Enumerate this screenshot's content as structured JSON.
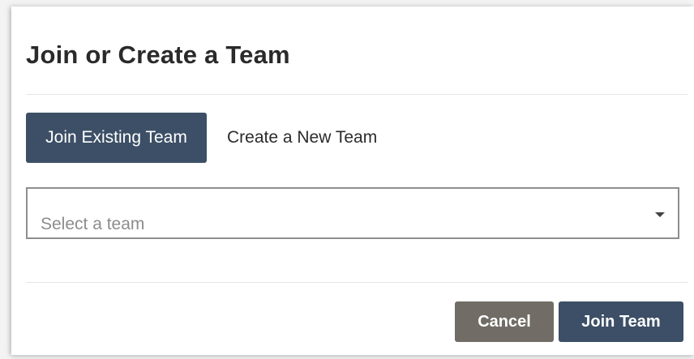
{
  "dialog": {
    "title": "Join or Create a Team"
  },
  "tabs": {
    "join_existing": "Join Existing Team",
    "create_new": "Create a New Team",
    "active": "join_existing"
  },
  "team_select": {
    "placeholder": "Select a team",
    "value": ""
  },
  "footer": {
    "cancel_label": "Cancel",
    "join_label": "Join Team"
  },
  "colors": {
    "primary": "#3c4f66",
    "secondary": "#716d66"
  }
}
